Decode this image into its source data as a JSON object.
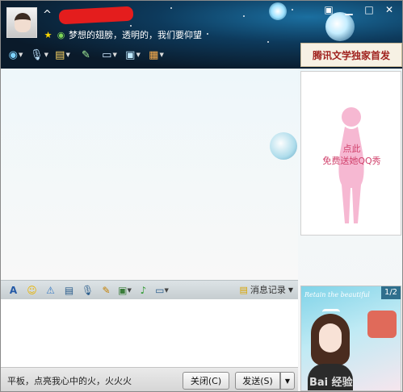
{
  "header": {
    "nickname_prefix": "^",
    "signature": "梦想的翅膀，透明的，我们要仰望",
    "window_controls": [
      "menu-icon",
      "minimize-icon",
      "maximize-icon",
      "close-icon"
    ]
  },
  "toolbar": {
    "items": [
      {
        "icon": "video-call-icon",
        "dropdown": true
      },
      {
        "icon": "voice-call-icon",
        "dropdown": true
      },
      {
        "icon": "file-transfer-icon",
        "dropdown": true
      },
      {
        "icon": "message-icon",
        "dropdown": false
      },
      {
        "icon": "remote-desktop-icon",
        "dropdown": true
      },
      {
        "icon": "share-screen-icon",
        "dropdown": true
      },
      {
        "icon": "apps-icon",
        "dropdown": true
      }
    ]
  },
  "ad_banner": {
    "text": "腾讯文学独家首发"
  },
  "show_panel": {
    "line1": "点此",
    "line2": "免费送她QQ秀"
  },
  "input_toolbar": {
    "items": [
      "font-icon",
      "emoji-icon",
      "shake-icon",
      "image-text-icon",
      "voice-message-icon",
      "doodle-icon",
      "screenshot-icon",
      "music-icon",
      "more-icon"
    ],
    "history_label": "消息记录"
  },
  "bottom_bar": {
    "status_message": "平板，点亮我心中的火，火火火",
    "close_label": "关闭(C)",
    "send_label": "发送(S)"
  },
  "ad2": {
    "caption": "Retain the beautiful",
    "page_indicator": "1/2",
    "watermark": "Bai 经验"
  }
}
